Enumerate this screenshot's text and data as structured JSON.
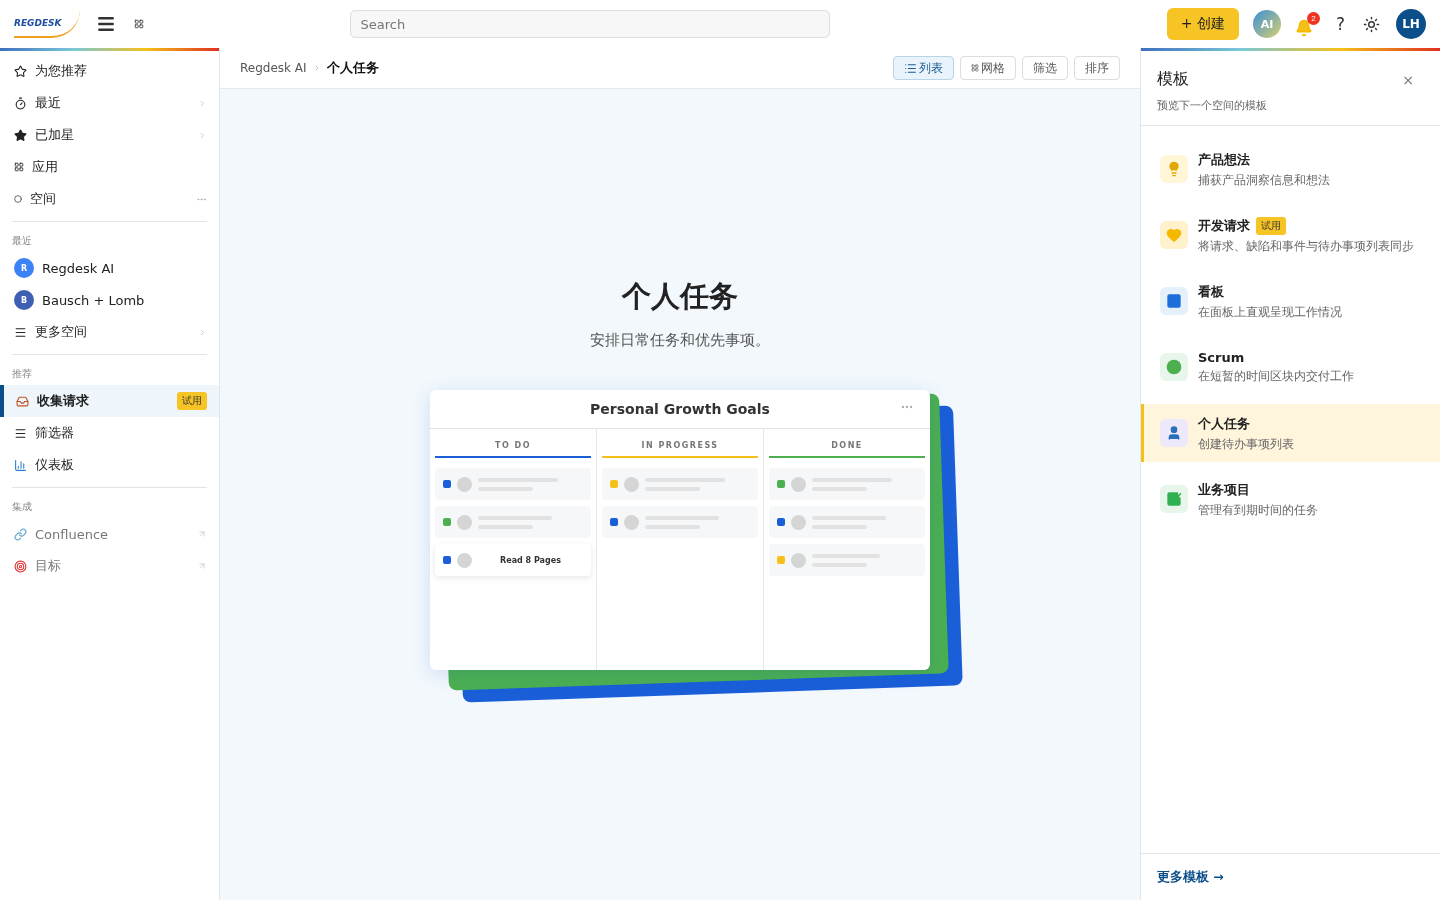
{
  "header": {
    "logo": "REGDESK",
    "search": {
      "placeholder": "Search"
    },
    "create_button": "+ 创建",
    "ai_avatar": "AI",
    "notifications": "2",
    "help": "?",
    "user_avatar": "LH"
  },
  "sidebar": {
    "nav": [
      {
        "label": "为您推荐",
        "chevron": false
      },
      {
        "label": "最近",
        "chevron": true
      },
      {
        "label": "已加星",
        "chevron": true
      },
      {
        "label": "应用",
        "chevron": false
      },
      {
        "label": "空间",
        "chevron": false,
        "more_menu": true
      }
    ],
    "recent": {
      "heading": "最近",
      "spaces": [
        {
          "label": "Regdesk AI",
          "avatar": "R",
          "color": "#3b82f6"
        },
        {
          "label": "Bausch + Lomb",
          "avatar": "B",
          "color": "#3f5fb5"
        }
      ],
      "more": {
        "label": "更多空间"
      }
    },
    "recommended": {
      "heading": "推荐",
      "items": [
        {
          "label": "收集请求",
          "badge": "试用",
          "selected": true
        },
        {
          "label": "筛选器",
          "selected": false
        },
        {
          "label": "仪表板",
          "selected": false
        }
      ]
    },
    "integrations": {
      "heading": "集成",
      "items": [
        {
          "label": "Confluence"
        },
        {
          "label": "目标"
        }
      ]
    }
  },
  "breadcrumb": [
    "Regdesk AI",
    "个人任务"
  ],
  "views": [
    {
      "label": "列表",
      "selected": true
    },
    {
      "label": "网格",
      "selected": false
    },
    {
      "label": "筛选",
      "selected": false
    },
    {
      "label": "排序",
      "selected": false
    }
  ],
  "hero": {
    "title": "个人任务",
    "subtitle": "安排日常任务和优先事项。"
  },
  "preview": {
    "title": "Personal Growth Goals",
    "columns": [
      {
        "name": "TO DO",
        "color": "#1a5fd8",
        "cards": [
          {
            "color": "#1a5fd8"
          },
          {
            "color": "#4caf50"
          },
          {
            "color": "#1a5fd8",
            "text": "Read 8 Pages"
          }
        ]
      },
      {
        "name": "IN PROGRESS",
        "color": "#f5c01a",
        "cards": [
          {
            "color": "#f5c01a"
          },
          {
            "color": "#1a5fd8"
          }
        ]
      },
      {
        "name": "DONE",
        "color": "#4caf50",
        "cards": [
          {
            "color": "#4caf50"
          },
          {
            "color": "#1a5fd8"
          },
          {
            "color": "#f5c01a"
          }
        ]
      }
    ]
  },
  "templates": {
    "title": "模板",
    "subtitle": "预览下一个空间的模板",
    "close": "×",
    "items": [
      {
        "title": "产品想法",
        "description": "捕获产品洞察信息和想法",
        "selected": false
      },
      {
        "title": "开发请求",
        "description": "将请求、缺陷和事件与待办事项列表同步",
        "badge": "试用",
        "selected": false
      },
      {
        "title": "看板",
        "description": "在面板上直观呈现工作情况",
        "selected": false
      },
      {
        "title": "Scrum",
        "description": "在短暂的时间区块内交付工作",
        "selected": false
      },
      {
        "title": "个人任务",
        "description": "创建待办事项列表",
        "selected": true
      },
      {
        "title": "业务项目",
        "description": "管理有到期时间的任务",
        "selected": false
      }
    ],
    "more_link": "更多模板 →"
  }
}
